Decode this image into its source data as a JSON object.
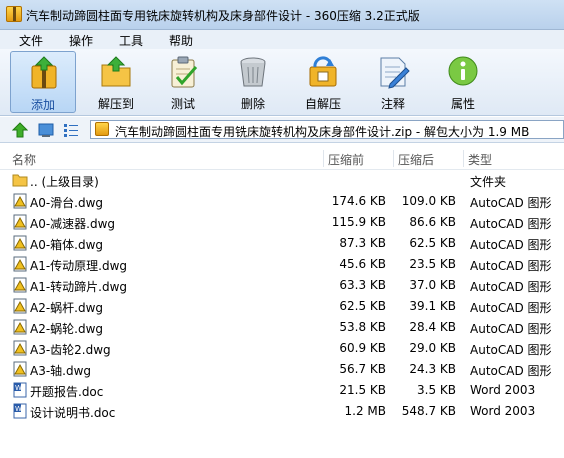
{
  "window": {
    "title": "汽车制动蹄圆柱面专用铣床旋转机构及床身部件设计 - 360压缩 3.2正式版"
  },
  "menu": [
    "文件",
    "操作",
    "工具",
    "帮助"
  ],
  "toolbar": [
    {
      "label": "添加",
      "icon": "add-archive-icon",
      "active": true
    },
    {
      "label": "解压到",
      "icon": "extract-folder-icon",
      "active": false
    },
    {
      "label": "测试",
      "icon": "test-clipboard-icon",
      "active": false
    },
    {
      "label": "删除",
      "icon": "delete-trash-icon",
      "active": false
    },
    {
      "label": "自解压",
      "icon": "self-extract-icon",
      "active": false
    },
    {
      "label": "注释",
      "icon": "comment-note-icon",
      "active": false
    },
    {
      "label": "属性",
      "icon": "info-icon",
      "active": false
    }
  ],
  "addressbar": {
    "path": "汽车制动蹄圆柱面专用铣床旋转机构及床身部件设计.zip - 解包大小为 1.9 MB"
  },
  "columns": {
    "name": "名称",
    "size": "压缩前",
    "packed": "压缩后",
    "type": "类型"
  },
  "files": [
    {
      "name": ".. (上级目录)",
      "size": "",
      "packed": "",
      "type": "文件夹",
      "icon": "folder-icon"
    },
    {
      "name": "A0-滑台.dwg",
      "size": "174.6 KB",
      "packed": "109.0 KB",
      "type": "AutoCAD 图形",
      "icon": "dwg-file-icon"
    },
    {
      "name": "A0-减速器.dwg",
      "size": "115.9 KB",
      "packed": "86.6 KB",
      "type": "AutoCAD 图形",
      "icon": "dwg-file-icon"
    },
    {
      "name": "A0-箱体.dwg",
      "size": "87.3 KB",
      "packed": "62.5 KB",
      "type": "AutoCAD 图形",
      "icon": "dwg-file-icon"
    },
    {
      "name": "A1-传动原理.dwg",
      "size": "45.6 KB",
      "packed": "23.5 KB",
      "type": "AutoCAD 图形",
      "icon": "dwg-file-icon"
    },
    {
      "name": "A1-转动蹄片.dwg",
      "size": "63.3 KB",
      "packed": "37.0 KB",
      "type": "AutoCAD 图形",
      "icon": "dwg-file-icon"
    },
    {
      "name": "A2-蜗杆.dwg",
      "size": "62.5 KB",
      "packed": "39.1 KB",
      "type": "AutoCAD 图形",
      "icon": "dwg-file-icon"
    },
    {
      "name": "A2-蜗轮.dwg",
      "size": "53.8 KB",
      "packed": "28.4 KB",
      "type": "AutoCAD 图形",
      "icon": "dwg-file-icon"
    },
    {
      "name": "A3-齿轮2.dwg",
      "size": "60.9 KB",
      "packed": "29.0 KB",
      "type": "AutoCAD 图形",
      "icon": "dwg-file-icon"
    },
    {
      "name": "A3-轴.dwg",
      "size": "56.7 KB",
      "packed": "24.3 KB",
      "type": "AutoCAD 图形",
      "icon": "dwg-file-icon"
    },
    {
      "name": "开题报告.doc",
      "size": "21.5 KB",
      "packed": "3.5 KB",
      "type": "Word 2003",
      "icon": "word-doc-icon"
    },
    {
      "name": "设计说明书.doc",
      "size": "1.2 MB",
      "packed": "548.7 KB",
      "type": "Word 2003",
      "icon": "word-doc-icon"
    }
  ]
}
